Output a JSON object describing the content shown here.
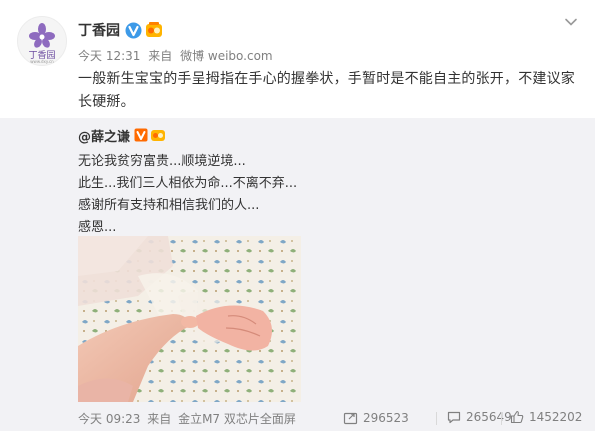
{
  "author": {
    "name": "丁香园",
    "avatar_text": "丁香园",
    "avatar_subtext": "www.dxy.cn",
    "verified_color": "#3d9ae8"
  },
  "meta": {
    "time": "今天 12:31",
    "from_label": "来自",
    "source": "微博 weibo.com"
  },
  "post": {
    "text_line1": "一般新生宝宝的手呈拇指在手心的握拳状，手暂时是不能自主的张开，不建议家",
    "text_line2": "长硬掰。"
  },
  "repost": {
    "author": "@薛之谦",
    "lines": [
      "无论我贫穷富贵...顺境逆境...",
      "此生...我们三人相依为命...不离不弃...",
      "感谢所有支持和相信我们的人...",
      "感恩..."
    ],
    "time": "今天 09:23",
    "from_label": "来自",
    "source": "金立M7 双芯片全面屏",
    "reposts": "296523",
    "comments": "265649",
    "likes": "1452202"
  },
  "colors": {
    "accent_orange": "#ff8200",
    "text": "#333333",
    "muted": "#808080",
    "repost_bg": "#f2f2f5"
  },
  "icons": {
    "verified": "verified-v-icon",
    "medal": "member-medal-icon",
    "chevron": "chevron-down-icon",
    "repost": "repost-icon",
    "comment": "comment-icon",
    "like": "like-icon"
  }
}
